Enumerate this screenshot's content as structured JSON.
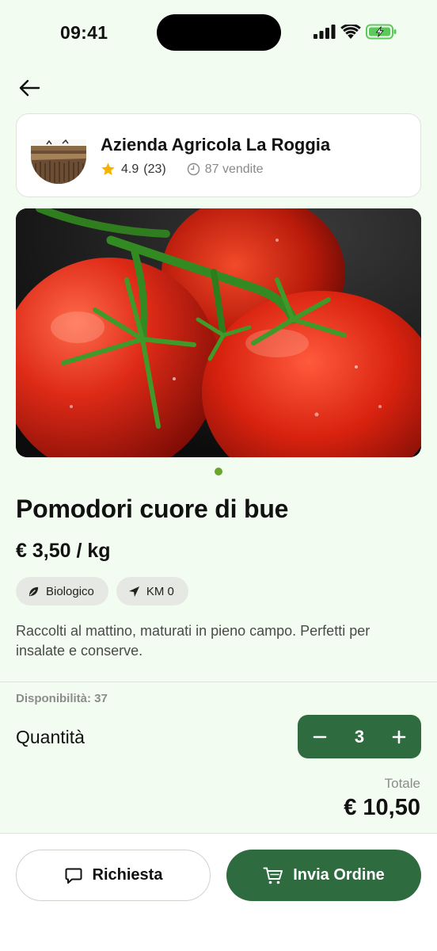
{
  "status_bar": {
    "time": "09:41"
  },
  "seller": {
    "name": "Azienda Agricola La Roggia",
    "rating": "4.9",
    "reviews": "(23)",
    "sales": "87 vendite"
  },
  "gallery": {
    "image_count": 1,
    "active_index": 0
  },
  "product": {
    "title": "Pomodori cuore di bue",
    "price": "€ 3,50 / kg",
    "tags": [
      {
        "label": "Biologico",
        "icon": "leaf-icon"
      },
      {
        "label": "KM 0",
        "icon": "navigation-arrow-icon"
      }
    ],
    "description": "Raccolti al mattino, maturati in pieno campo. Perfetti per insalate e conserve."
  },
  "order": {
    "availability": "Disponibilità: 37",
    "quantity_label": "Quantità",
    "quantity": "3",
    "total_label": "Totale",
    "total_value": "€ 10,50"
  },
  "actions": {
    "request_label": "Richiesta",
    "order_label": "Invia Ordine"
  },
  "colors": {
    "background": "#f3fcf1",
    "primary_green": "#2e6b3f",
    "star": "#f5b301",
    "page_dot": "#6aa52e"
  }
}
